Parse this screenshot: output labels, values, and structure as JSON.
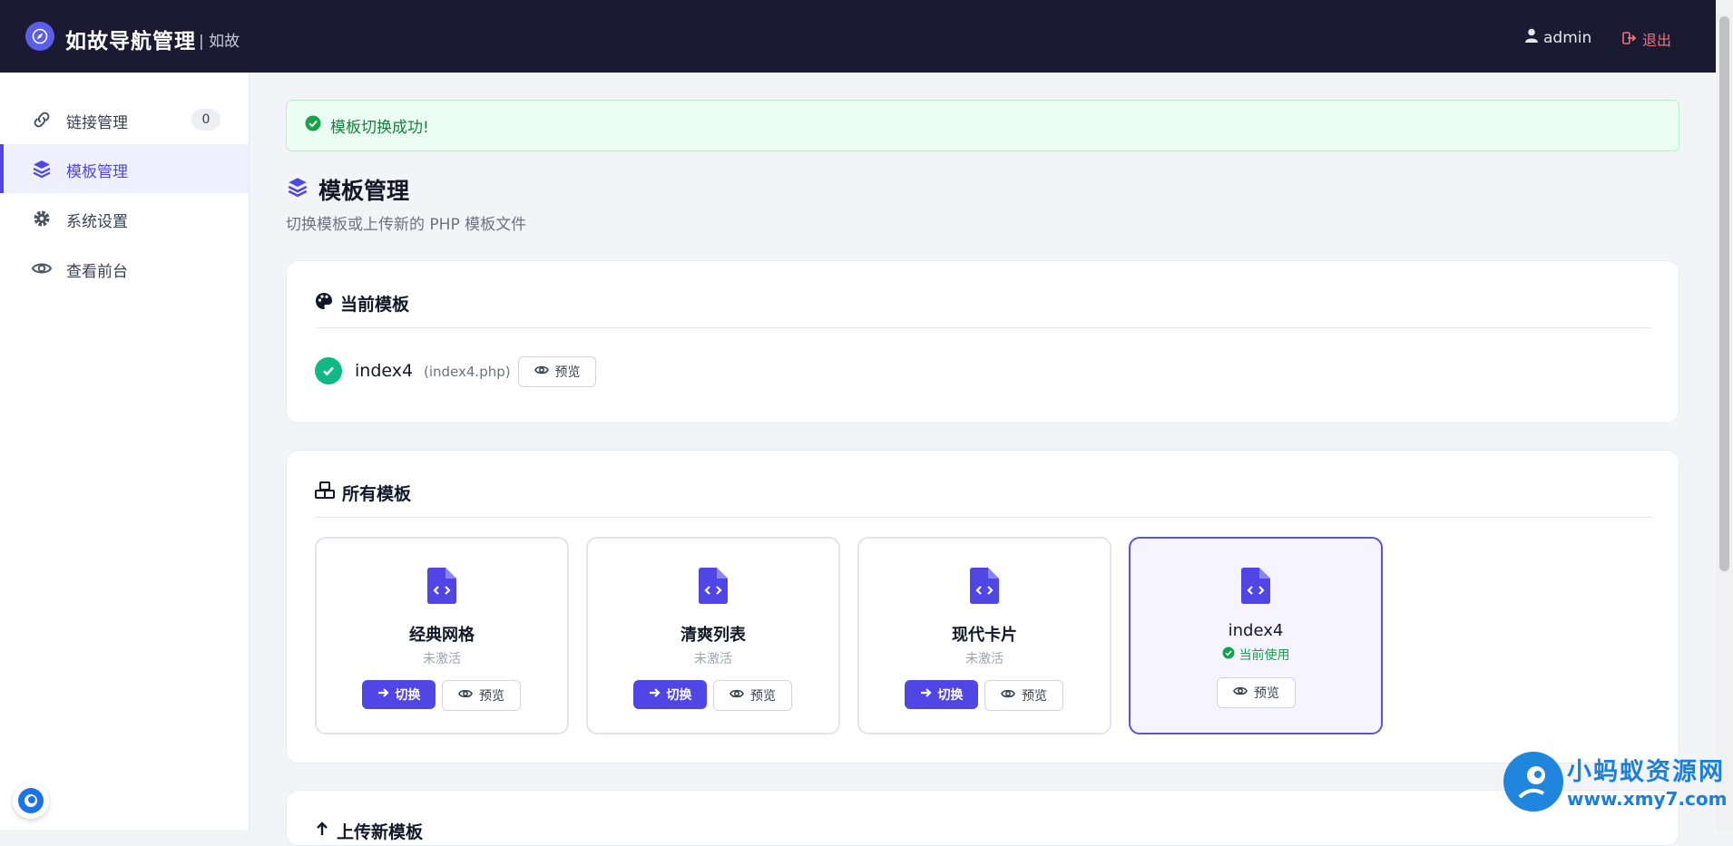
{
  "header": {
    "title": "如故导航管理",
    "subtitle": "| 如故",
    "username": "admin",
    "logout_label": "退出"
  },
  "sidebar": {
    "items": [
      {
        "label": "链接管理",
        "icon": "link-icon",
        "badge": "0"
      },
      {
        "label": "模板管理",
        "icon": "layers-icon",
        "active": true
      },
      {
        "label": "系统设置",
        "icon": "gear-icon"
      },
      {
        "label": "查看前台",
        "icon": "eye-icon"
      }
    ]
  },
  "alert": {
    "text": "模板切换成功!",
    "icon": "check-circle-icon",
    "color": "#15803d"
  },
  "page": {
    "title": "模板管理",
    "subtitle": "切换模板或上传新的 PHP 模板文件"
  },
  "current_template": {
    "section_title": "当前模板",
    "name": "index4",
    "file": "(index4.php)",
    "preview_label": "预览"
  },
  "all_templates": {
    "section_title": "所有模板",
    "items": [
      {
        "name": "经典网格",
        "status": "未激活",
        "switch_label": "切换",
        "preview_label": "预览"
      },
      {
        "name": "清爽列表",
        "status": "未激活",
        "switch_label": "切换",
        "preview_label": "预览"
      },
      {
        "name": "现代卡片",
        "status": "未激活",
        "switch_label": "切换",
        "preview_label": "预览"
      },
      {
        "name": "index4",
        "status": "当前使用",
        "preview_label": "预览",
        "active": true
      }
    ]
  },
  "upload": {
    "section_title": "上传新模板"
  },
  "watermark": {
    "name": "小蚂蚁资源网",
    "url": "www.xmy7.com"
  },
  "colors": {
    "accent": "#4f46e5",
    "header_bg": "#1a1b33",
    "success": "#10b981",
    "danger": "#f87171"
  }
}
